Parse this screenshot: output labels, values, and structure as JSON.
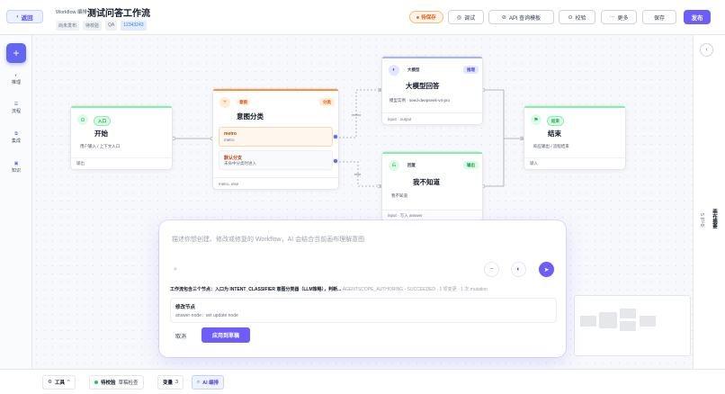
{
  "header": {
    "back_label": "返回",
    "eyebrow": "Workflow 编排",
    "title": "测试问答工作流",
    "tags": [
      "尚未发布",
      "待校验",
      "QA",
      "12343243"
    ],
    "pending_label": "待保存",
    "buttons": {
      "debug": "调试",
      "api": "API 查询模板",
      "validate": "校验",
      "more": "更多",
      "save": "保存",
      "publish": "发布"
    }
  },
  "rail": {
    "items": [
      {
        "icon": "reason-icon",
        "label": "推理"
      },
      {
        "icon": "flow-icon",
        "label": "流程"
      },
      {
        "icon": "integration-icon",
        "label": "集成"
      },
      {
        "icon": "knowledge-icon",
        "label": "知识"
      }
    ]
  },
  "nodes": {
    "start": {
      "type": "入口",
      "title": "开始",
      "desc": "用户输入 / 上下文入口",
      "foot": "输出"
    },
    "classify": {
      "type": "意图",
      "badge": "分类",
      "title": "意图分类",
      "branches": [
        {
          "name": "metro",
          "sub": "metro"
        },
        {
          "name": "默认分支",
          "sub": "未命中分类时进入"
        }
      ],
      "foot": "metro, else"
    },
    "llm": {
      "type": "大模型",
      "badge": "推理",
      "title": "大模型回答",
      "desc": "模型实例 · seed-deepseek-v4-pro",
      "foot": "input · output"
    },
    "idk": {
      "type": "回复",
      "badge": "输出",
      "title": "我不知道",
      "desc": "我不知道",
      "foot": "input · 写入 answer"
    },
    "end": {
      "type": "结束",
      "title": "结束",
      "desc": "响应输出 / 流程结束",
      "foot": "输入"
    }
  },
  "edge_labels": {
    "metro": "metro",
    "else": "else"
  },
  "ai_panel": {
    "placeholder": "描述你想创建、修改或修复的 Workflow，AI 会结合当前画布理解意图",
    "status_text": "工作流包含三个节点：入口为 INTENT_CLASSIFIER 意图分类器（LLM策略），判断...",
    "status_meta": "AGENTSCOPE_AUTHORING · SUCCEEDED · 1 项变更 · 1 次 mutation",
    "card_title": "修改节点",
    "card_sub": "answer-node：set update node",
    "cancel": "取消",
    "apply": "应用到草稿"
  },
  "right": {
    "title": "画布摘要",
    "sub": "5 节点"
  },
  "bottom": {
    "tools": "工具",
    "validate_status": "待校验",
    "validate_label": "草稿检查",
    "vars_label": "变量",
    "vars_count": "3",
    "ai_edit": "AI 编排"
  },
  "colors": {
    "accent": "#6d5dfc",
    "start_green": "#22c55e",
    "classify_orange": "#f97316",
    "llm_indigo": "#6366f1",
    "pending_orange": "#ea580c"
  }
}
